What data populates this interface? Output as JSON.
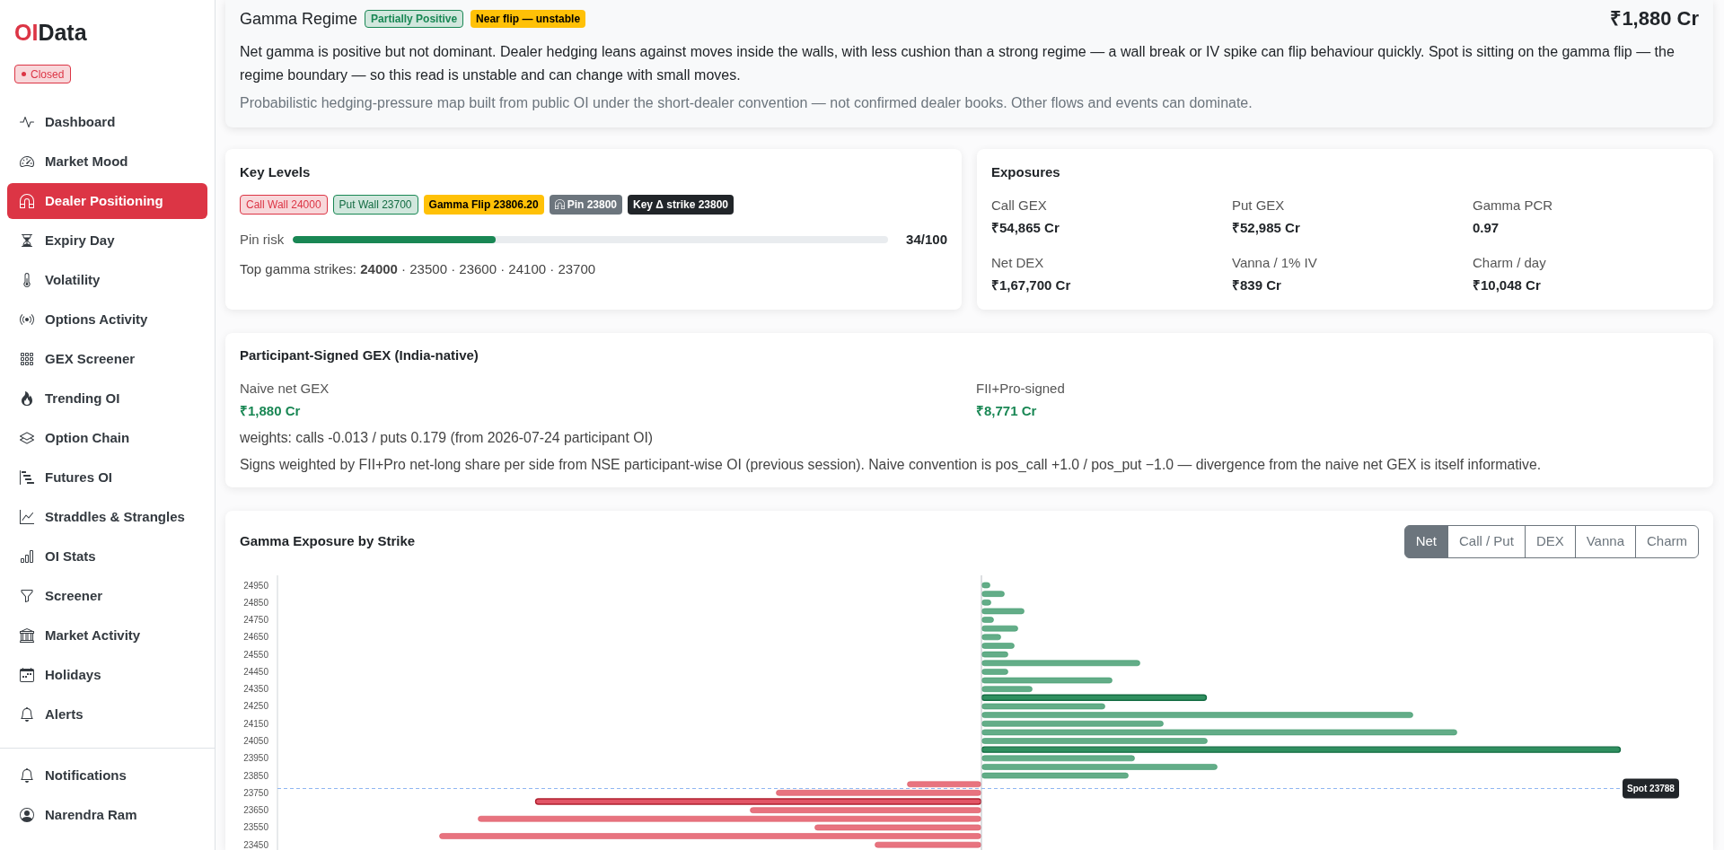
{
  "sidebar": {
    "logo": {
      "accent": "OI",
      "rest": "Data"
    },
    "status": "Closed",
    "nav": [
      {
        "label": "Dashboard",
        "selected": false
      },
      {
        "label": "Market Mood",
        "selected": false
      },
      {
        "label": "Dealer Positioning",
        "selected": true
      },
      {
        "label": "Expiry Day",
        "selected": false
      },
      {
        "label": "Volatility",
        "selected": false
      },
      {
        "label": "Options Activity",
        "selected": false
      },
      {
        "label": "GEX Screener",
        "selected": false
      },
      {
        "label": "Trending OI",
        "selected": false
      },
      {
        "label": "Option Chain",
        "selected": false
      },
      {
        "label": "Futures OI",
        "selected": false
      },
      {
        "label": "Straddles & Strangles",
        "selected": false
      },
      {
        "label": "OI Stats",
        "selected": false
      },
      {
        "label": "Screener",
        "selected": false
      },
      {
        "label": "Market Activity",
        "selected": false
      },
      {
        "label": "Holidays",
        "selected": false
      },
      {
        "label": "Alerts",
        "selected": false
      }
    ],
    "footer": [
      {
        "label": "Notifications"
      },
      {
        "label": "Narendra Ram"
      }
    ]
  },
  "regime": {
    "title": "Gamma Regime",
    "badges": [
      {
        "label": "Partially Positive",
        "kind": "positive"
      },
      {
        "label": "Near flip — unstable",
        "kind": "warning"
      }
    ],
    "value": "₹1,880 Cr",
    "summary": "Net gamma is positive but not dominant. Dealer hedging leans against moves inside the walls, with less cushion than a strong regime — a wall break or IV spike can flip behaviour quickly. Spot is sitting on the gamma flip — the regime boundary — so this read is unstable and can change with small moves.",
    "disclaimer": "Probabilistic hedging-pressure map built from public OI under the short-dealer convention — not confirmed dealer books. Other flows and events can dominate."
  },
  "key_levels": {
    "title": "Key Levels",
    "badges": [
      {
        "label": "Call Wall 24000",
        "kind": "call"
      },
      {
        "label": "Put Wall 23700",
        "kind": "put"
      },
      {
        "label": "Gamma Flip 23806.20",
        "kind": "flip"
      },
      {
        "label": "Pin 23800",
        "kind": "pin"
      },
      {
        "label": "Key Δ strike 23800",
        "kind": "key"
      }
    ],
    "pin_risk": {
      "label": "Pin risk",
      "level": 0.34,
      "reading": "34/100"
    },
    "top_strikes": "Top gamma strikes: **24000** · 23500 · 23600 · 24100 · 23700"
  },
  "exposures": {
    "title": "Exposures",
    "items": [
      {
        "label": "Call GEX",
        "value": "₹54,865 Cr"
      },
      {
        "label": "Put GEX",
        "value": "₹52,985 Cr"
      },
      {
        "label": "Gamma PCR",
        "value": "0.97"
      },
      {
        "label": "Net DEX",
        "value": "₹1,67,700 Cr"
      },
      {
        "label": "Vanna / 1% IV",
        "value": "₹839 Cr"
      },
      {
        "label": "Charm / day",
        "value": "₹10,048 Cr"
      }
    ]
  },
  "participant": {
    "title": "Participant-Signed GEX (India-native)",
    "metrics": [
      {
        "label": "Naive net GEX",
        "value": "₹1,880 Cr"
      },
      {
        "label": "FII+Pro-signed",
        "value": "₹8,771 Cr"
      }
    ],
    "weights": "weights: calls -0.013 / puts 0.179 (from 2026-07-24 participant OI)",
    "note": "Signs weighted by FII+Pro net-long share per side from NSE participant-wise OI (previous session). Naive convention is pos_call +1.0 / pos_put −1.0 — divergence from the naive net GEX is itself informative."
  },
  "gex_chart": {
    "title": "Gamma Exposure by Strike",
    "modes": [
      {
        "label": "Net",
        "selected": true
      },
      {
        "label": "Call / Put",
        "selected": false
      },
      {
        "label": "DEX",
        "selected": false
      },
      {
        "label": "Vanna",
        "selected": false
      },
      {
        "label": "Charm",
        "selected": false
      }
    ],
    "strike_labels": [
      "24950",
      "24850",
      "24750",
      "24650",
      "24550",
      "24450",
      "24350",
      "24250",
      "24150",
      "24050",
      "23950",
      "23850",
      "23750",
      "23650",
      "23550",
      "23450"
    ],
    "spot_label": "Spot 23788"
  }
}
